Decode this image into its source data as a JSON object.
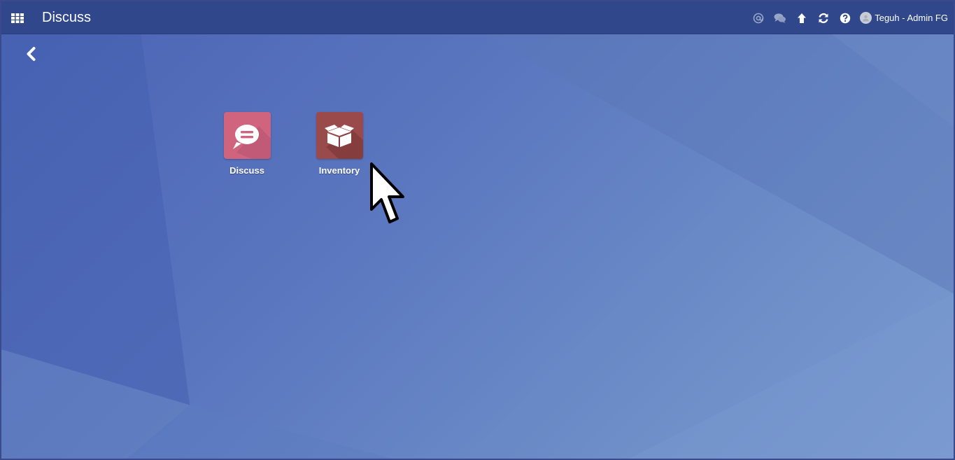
{
  "header": {
    "title": "Discuss",
    "apps_icon": "grid-icon",
    "user_name": "Teguh - Admin FG"
  },
  "systray": [
    {
      "icon": "at-icon"
    },
    {
      "icon": "chat-bubbles-icon"
    },
    {
      "icon": "arrow-up-icon"
    },
    {
      "icon": "refresh-icon"
    },
    {
      "icon": "help-icon"
    }
  ],
  "nav": {
    "back_icon": "chevron-left-icon"
  },
  "apps": [
    {
      "label": "Discuss",
      "icon": "chat-bubble-icon",
      "color": "#d0647f"
    },
    {
      "label": "Inventory",
      "icon": "box-icon",
      "color": "#9a4a4a"
    }
  ],
  "colors": {
    "topbar": "#30478c",
    "background": "#5a76bf"
  }
}
